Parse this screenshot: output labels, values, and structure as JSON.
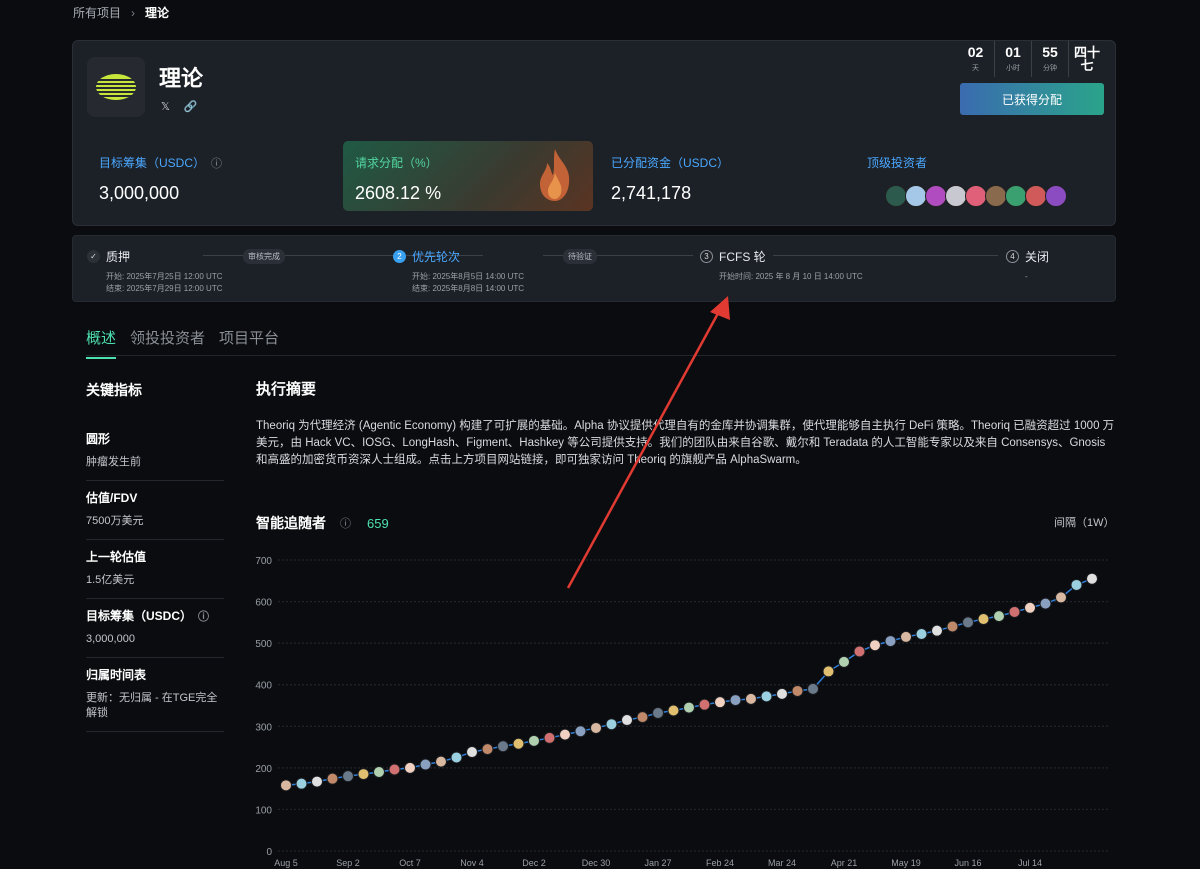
{
  "breadcrumb": {
    "root": "所有项目",
    "current": "理论"
  },
  "project": {
    "title": "理论"
  },
  "countdown": [
    {
      "num": "02",
      "unit": "天"
    },
    {
      "num": "01",
      "unit": "小时"
    },
    {
      "num": "55",
      "unit": "分钟"
    },
    {
      "num": "四十七",
      "unit": ""
    }
  ],
  "alloc_button": "已获得分配",
  "metrics": [
    {
      "label": "目标筹集（USDC）",
      "value": "3,000,000"
    },
    {
      "label": "请求分配（%）",
      "value": "2608.12 %"
    },
    {
      "label": "已分配资金（USDC）",
      "value": "2,741,178"
    },
    {
      "label": "顶级投资者",
      "value": ""
    }
  ],
  "investor_colors": [
    "#2c5a4c",
    "#a6c8e8",
    "#b14cc0",
    "#c8c8d0",
    "#e0607a",
    "#8a6a4c",
    "#3aa070",
    "#d05a5a",
    "#8a4cc0"
  ],
  "timeline": {
    "stages": [
      {
        "name": "质押",
        "icon": "✓",
        "date1": "开始: 2025年7月25日 12:00 UTC",
        "date2": "结束: 2025年7月29日 12:00 UTC"
      },
      {
        "name": "优先轮次",
        "icon": "2",
        "date1": "开始: 2025年8月5日 14:00 UTC",
        "date2": "结束: 2025年8月8日 14:00 UTC"
      },
      {
        "name": "FCFS 轮",
        "icon": "3",
        "date1": "开始时间:  2025 年 8 月 10 日 14:00 UTC",
        "date2": ""
      },
      {
        "name": "关闭",
        "icon": "4",
        "date1": "-",
        "date2": ""
      }
    ],
    "pills": [
      "审核完成",
      "待验证"
    ]
  },
  "tabs": [
    "概述",
    "领投投资者",
    "项目平台"
  ],
  "sidebar": {
    "title": "关键指标",
    "items": [
      {
        "k": "圆形",
        "v": "肿瘤发生前"
      },
      {
        "k": "估值/FDV",
        "v": "7500万美元"
      },
      {
        "k": "上一轮估值",
        "v": "1.5亿美元"
      },
      {
        "k": "目标筹集（USDC）",
        "v": "3,000,000"
      },
      {
        "k": "归属时间表",
        "v": "更新：无归属 - 在TGE完全解锁"
      }
    ]
  },
  "summary": {
    "title": "执行摘要",
    "text": "Theoriq 为代理经济 (Agentic Economy) 构建了可扩展的基础。Alpha 协议提供代理自有的金库并协调集群，使代理能够自主执行 DeFi 策略。Theoriq 已融资超过 1000 万美元，由 Hack VC、IOSG、LongHash、Figment、Hashkey 等公司提供支持。我们的团队由来自谷歌、戴尔和 Teradata 的人工智能专家以及来自 Consensys、Gnosis 和高盛的加密货币资深人士组成。点击上方项目网站链接，即可独家访问 Theoriq 的旗舰产品 AlphaSwarm。"
  },
  "followers": {
    "title": "智能追随者",
    "count": "659",
    "interval": "间隔（1W）"
  },
  "chart_data": {
    "type": "line",
    "title": "智能追随者",
    "x_ticks": [
      "Aug 5",
      "Sep 2",
      "Oct 7",
      "Nov 4",
      "Dec 2",
      "Dec 30",
      "Jan 27",
      "Feb 24",
      "Mar 24",
      "Apr 21",
      "May 19",
      "Jun 16",
      "Jul 14"
    ],
    "y_ticks": [
      0,
      100,
      200,
      300,
      400,
      500,
      600,
      700
    ],
    "ylim": [
      0,
      700
    ],
    "x_range_weeks": [
      0,
      52
    ],
    "series": [
      {
        "x": [
          0,
          1,
          2,
          3,
          4,
          5,
          6,
          7,
          8,
          9,
          10,
          11,
          12,
          13,
          14,
          15,
          16,
          17,
          18,
          19,
          20,
          21,
          22,
          23,
          24,
          25,
          26,
          27,
          28,
          29,
          30,
          31,
          32,
          33,
          34,
          35,
          36,
          37,
          38,
          39,
          40,
          41,
          42,
          43,
          44,
          45,
          46,
          47,
          48,
          49,
          50,
          51,
          52
        ],
        "values": [
          158,
          162,
          167,
          174,
          180,
          185,
          190,
          196,
          200,
          208,
          215,
          225,
          238,
          245,
          252,
          258,
          265,
          272,
          280,
          288,
          296,
          305,
          315,
          322,
          332,
          338,
          345,
          352,
          358,
          363,
          366,
          372,
          378,
          385,
          390,
          432,
          455,
          480,
          495,
          505,
          515,
          522,
          530,
          540,
          550,
          558,
          565,
          575,
          585,
          595,
          610,
          640,
          655
        ]
      }
    ],
    "grid": true
  },
  "colors": {
    "accent": "#4de0b0",
    "link": "#4aa8ff",
    "line": "#2f7fd8"
  }
}
